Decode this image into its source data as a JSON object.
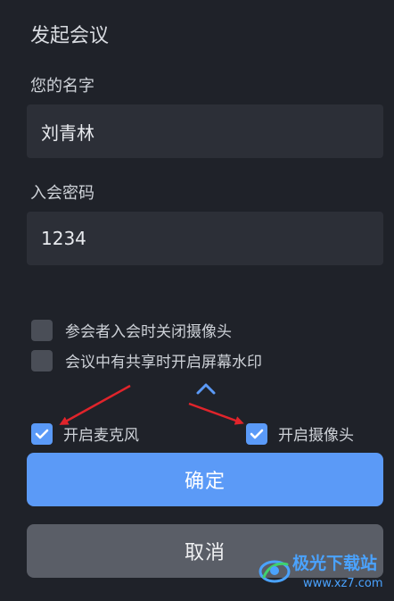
{
  "dialog": {
    "title": "发起会议",
    "name_label": "您的名字",
    "name_value": "刘青林",
    "password_label": "入会密码",
    "password_value": "1234"
  },
  "options": [
    {
      "label": "参会者入会时关闭摄像头",
      "checked": false
    },
    {
      "label": "会议中有共享时开启屏幕水印",
      "checked": false
    }
  ],
  "collapse_icon": "chevron-up-icon",
  "media": {
    "mic_label": "开启麦克风",
    "mic_checked": true,
    "camera_label": "开启摄像头",
    "camera_checked": true
  },
  "buttons": {
    "confirm": "确定",
    "cancel": "取消"
  },
  "watermark": {
    "text": "极光下载站",
    "url": "www.xz7.com"
  },
  "colors": {
    "background": "#1f2229",
    "input_bg": "#2c2f37",
    "accent": "#5b9af7",
    "secondary_button": "#5a5e67",
    "annotation_arrow": "#e0242b"
  }
}
